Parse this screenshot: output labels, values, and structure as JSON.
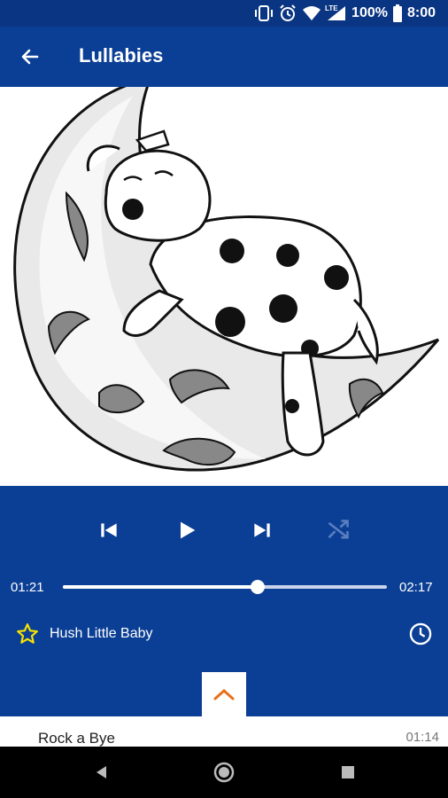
{
  "status_bar": {
    "battery": "100%",
    "time": "8:00",
    "network": "LTE",
    "icons": [
      "vibrate-icon",
      "alarm-icon",
      "wifi-icon",
      "signal-icon",
      "battery-icon"
    ]
  },
  "app_bar": {
    "title": "Lullabies",
    "back_icon": "arrow-left-icon"
  },
  "player": {
    "elapsed": "01:21",
    "duration": "02:17",
    "progress_fraction": 0.6,
    "now_playing": "Hush Little Baby",
    "controls": [
      "skip-previous-icon",
      "play-icon",
      "skip-next-icon",
      "shuffle-icon"
    ],
    "shuffle_enabled": false
  },
  "playlist": {
    "items": [
      {
        "title": "Rock a Bye",
        "duration": "01:14"
      }
    ]
  },
  "colors": {
    "primary": "#0b3f95",
    "status_bar": "#0a3582",
    "accent_star": "#f7e400",
    "drawer_chevron": "#e8701a"
  }
}
